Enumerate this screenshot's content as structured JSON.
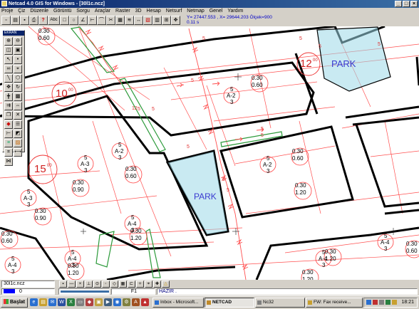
{
  "window": {
    "title": "Netcad 4.0 GIS for Windows - [30l1c.ncz]",
    "buttons": [
      "_",
      "□",
      "×"
    ]
  },
  "menu": [
    "Proje",
    "Çiz",
    "Düzenle",
    "Görüntü",
    "Sorgu",
    "Araçlar",
    "Raster",
    "3D",
    "Hesap",
    "Netsurf",
    "Netmap",
    "Genel",
    "Yardım"
  ],
  "toolbar": {
    "abc_label": "Abc",
    "help_label": "?"
  },
  "coords": {
    "line1": "Y= 27447.553 , X= 29644.203 Ölçek=900",
    "line2": "0.11 s"
  },
  "palette": {
    "title": "EKRAN"
  },
  "map": {
    "block_labels": [
      "12",
      "10",
      "15"
    ],
    "block_sup": [
      "00",
      "00",
      "00"
    ],
    "park_labels": [
      "PARK",
      "PARK"
    ],
    "parcels": [
      {
        "top": "5",
        "mid": "A-2",
        "bot": "3"
      },
      {
        "top": "5",
        "mid": "A-2",
        "bot": "3"
      },
      {
        "top": "5",
        "mid": "A-3",
        "bot": "3"
      },
      {
        "top": "5",
        "mid": "A-2",
        "bot": "3"
      },
      {
        "top": "5",
        "mid": "A-3",
        "bot": "3"
      },
      {
        "top": "5",
        "mid": "A-4",
        "bot": "3"
      },
      {
        "top": "5",
        "mid": "A-4",
        "bot": "3"
      },
      {
        "top": "5",
        "mid": "A-4",
        "bot": "3"
      },
      {
        "top": "5",
        "mid": "A-4",
        "bot": "3"
      },
      {
        "top": "5",
        "mid": "A-4",
        "bot": "3"
      },
      {
        "top": "5",
        "mid": "A-4",
        "bot": "3"
      }
    ],
    "ratios": [
      {
        "a": "0.30",
        "b": "0.60"
      },
      {
        "a": "0.30",
        "b": "0.60"
      },
      {
        "a": "0.30",
        "b": "0.60"
      },
      {
        "a": "0.30",
        "b": "0.60"
      },
      {
        "a": "0.30",
        "b": "0.90"
      },
      {
        "a": "0.30",
        "b": "1.20"
      },
      {
        "a": "0.30",
        "b": "0.90"
      },
      {
        "a": "0.30",
        "b": "1.20"
      },
      {
        "a": "0.30",
        "b": "1.20"
      },
      {
        "a": "0.30",
        "b": "1.20"
      },
      {
        "a": "0.30",
        "b": "0.60"
      },
      {
        "a": "0.30",
        "b": "0.60"
      },
      {
        "a": "0.30",
        "b": "1.20"
      }
    ],
    "dims": [
      "5",
      "5",
      "5",
      "5",
      "5",
      "5",
      "5",
      "5",
      "5",
      "5",
      "5",
      "12",
      "5"
    ]
  },
  "status": {
    "file": "30l1c.ncz",
    "layer": "0",
    "func_key": "F1",
    "message": "HAZIR ."
  },
  "taskbar": {
    "start": "Başlat",
    "tasks": [
      "Inbox - Microsoft...",
      "NETCAD",
      "Nc32",
      "FW: Fax receive..."
    ],
    "clock": "18:21"
  },
  "colors": {
    "road": "#000000",
    "parcel": "#ff5050",
    "park": "#9cd8e8",
    "green_strip": "#2c9a3a",
    "label": "#3a3ad0"
  }
}
